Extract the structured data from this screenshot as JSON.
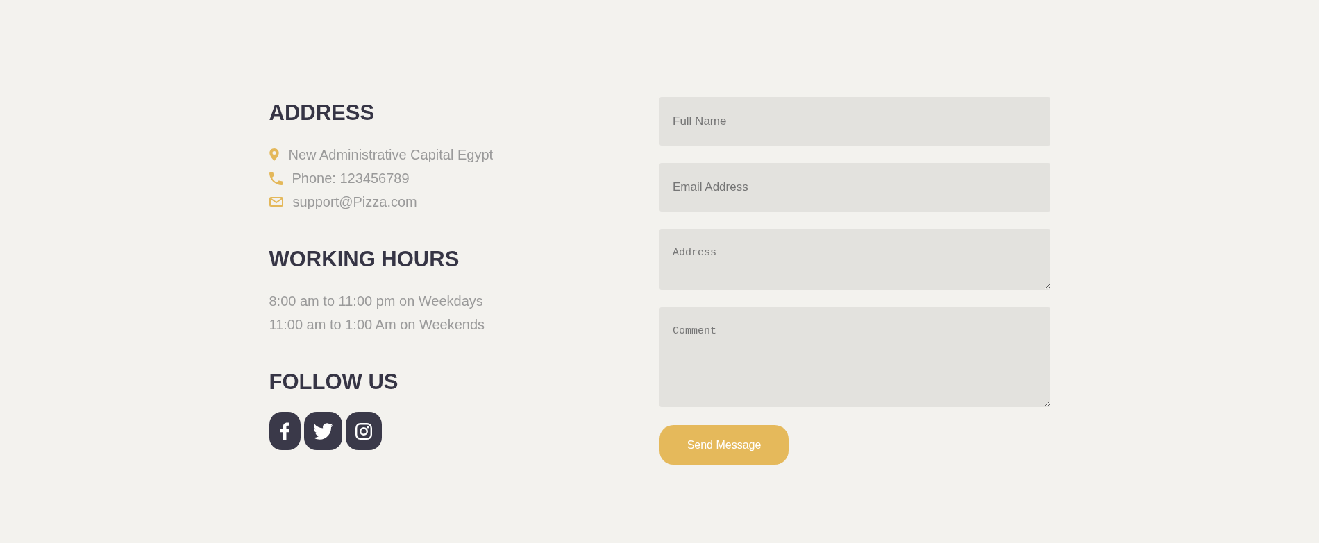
{
  "address": {
    "heading": "ADDRESS",
    "items": [
      {
        "kind": "location",
        "text": "New Administrative Capital Egypt"
      },
      {
        "kind": "phone",
        "text": "Phone: 123456789"
      },
      {
        "kind": "email",
        "text": "support@Pizza.com"
      }
    ]
  },
  "working_hours": {
    "heading": "WORKING HOURS",
    "lines": [
      "8:00 am to 11:00 pm on Weekdays",
      "11:00 am to 1:00 Am on Weekends"
    ]
  },
  "follow_us": {
    "heading": "FOLLOW US",
    "links": [
      {
        "kind": "facebook"
      },
      {
        "kind": "twitter"
      },
      {
        "kind": "instagram"
      }
    ]
  },
  "form": {
    "fields": [
      {
        "kind": "input",
        "placeholder": "Full Name"
      },
      {
        "kind": "input",
        "placeholder": "Email Address"
      },
      {
        "kind": "textarea",
        "placeholder": "Address"
      },
      {
        "kind": "textarea",
        "placeholder": "Comment"
      }
    ],
    "submit_button": "Send Message"
  }
}
